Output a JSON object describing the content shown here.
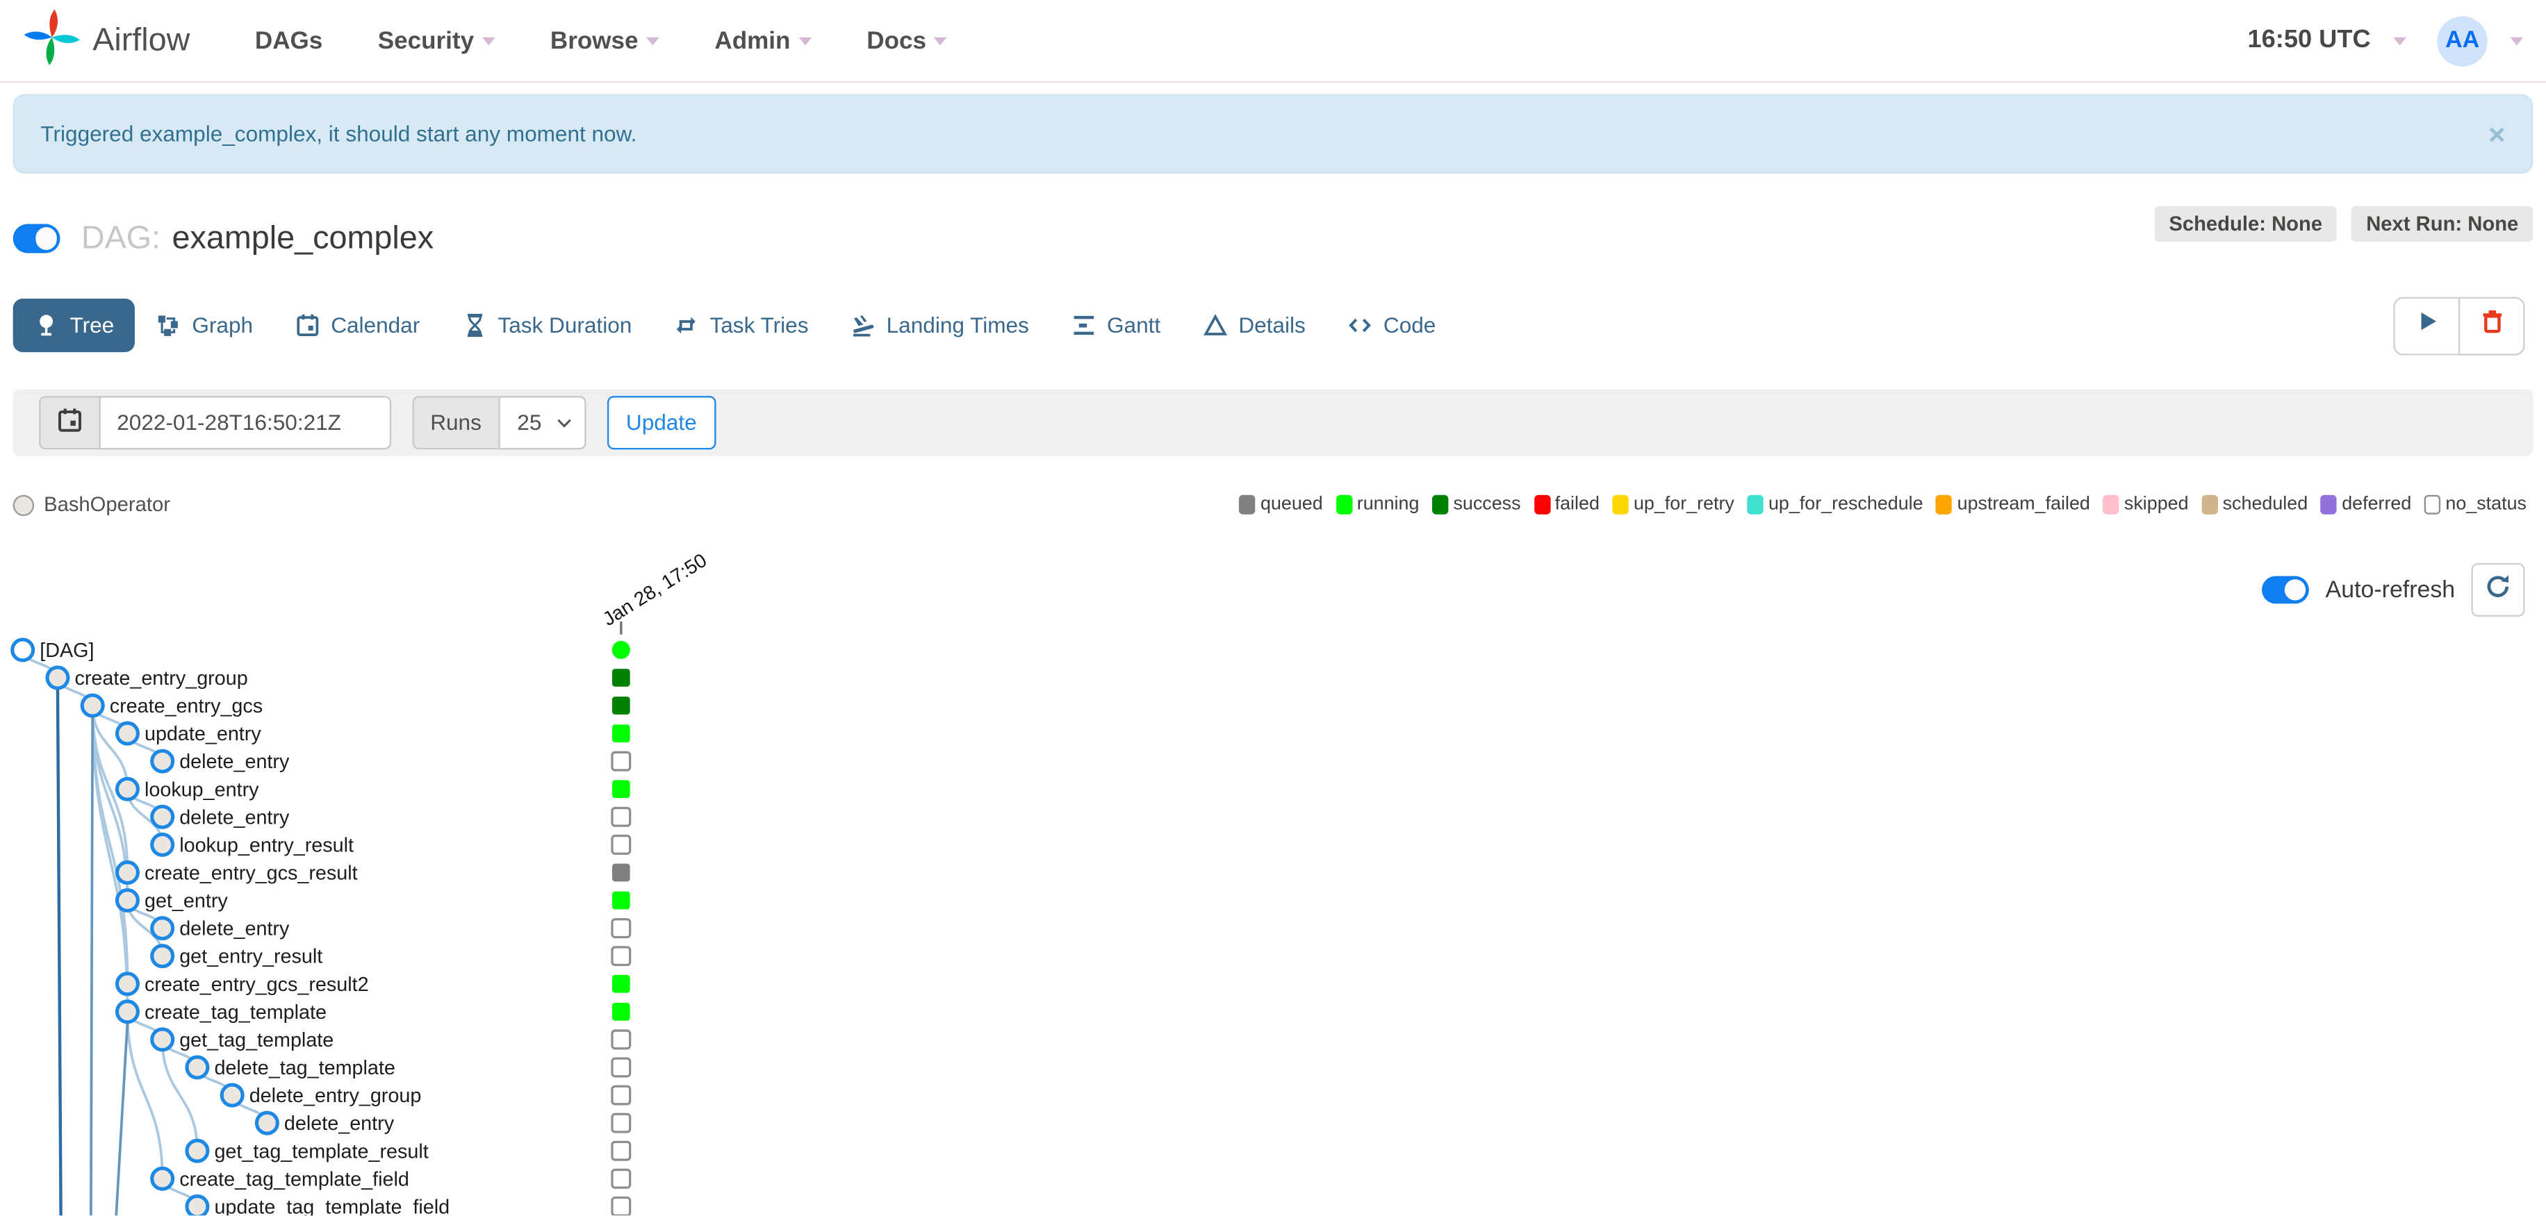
{
  "nav": {
    "brand": "Airflow",
    "items": [
      {
        "label": "DAGs",
        "caret": false
      },
      {
        "label": "Security",
        "caret": true
      },
      {
        "label": "Browse",
        "caret": true
      },
      {
        "label": "Admin",
        "caret": true
      },
      {
        "label": "Docs",
        "caret": true
      }
    ],
    "clock": "16:50 UTC",
    "avatar_initials": "AA"
  },
  "alert": {
    "message": "Triggered example_complex, it should start any moment now.",
    "close_symbol": "×"
  },
  "dag": {
    "label_prefix": "DAG:",
    "name": "example_complex",
    "schedule_badge": "Schedule: None",
    "next_run_badge": "Next Run: None"
  },
  "tabs": [
    {
      "label": "Tree",
      "icon": "tree-icon",
      "active": true
    },
    {
      "label": "Graph",
      "icon": "graph-icon",
      "active": false
    },
    {
      "label": "Calendar",
      "icon": "calendar-icon",
      "active": false
    },
    {
      "label": "Task Duration",
      "icon": "hourglass-icon",
      "active": false
    },
    {
      "label": "Task Tries",
      "icon": "repeat-icon",
      "active": false
    },
    {
      "label": "Landing Times",
      "icon": "plane-landing-icon",
      "active": false
    },
    {
      "label": "Gantt",
      "icon": "gantt-icon",
      "active": false
    },
    {
      "label": "Details",
      "icon": "details-icon",
      "active": false
    },
    {
      "label": "Code",
      "icon": "code-icon",
      "active": false
    }
  ],
  "filter": {
    "date_value": "2022-01-28T16:50:21Z",
    "runs_label": "Runs",
    "runs_selected": "25",
    "update_label": "Update"
  },
  "legend": {
    "operator": {
      "label": "BashOperator",
      "fill": "#ece6e0",
      "border": "#9a9a9a"
    },
    "statuses": [
      {
        "label": "queued",
        "color": "#808080"
      },
      {
        "label": "running",
        "color": "#00FF00"
      },
      {
        "label": "success",
        "color": "#008000"
      },
      {
        "label": "failed",
        "color": "#FF0000"
      },
      {
        "label": "up_for_retry",
        "color": "#FFD700"
      },
      {
        "label": "up_for_reschedule",
        "color": "#40E0D0"
      },
      {
        "label": "upstream_failed",
        "color": "#FFA500"
      },
      {
        "label": "skipped",
        "color": "#FFC0CB"
      },
      {
        "label": "scheduled",
        "color": "#D2B48C"
      },
      {
        "label": "deferred",
        "color": "#9370DB"
      },
      {
        "label": "no_status",
        "color": "#FFFFFF",
        "border": "#8E8E8E"
      }
    ]
  },
  "auto_refresh": {
    "label": "Auto-refresh",
    "enabled": true
  },
  "tree": {
    "run_label": "Jan 28, 17:50",
    "dag_run_status": "running",
    "node_fill": "#ece6e0",
    "node_stroke": "#1e88e5",
    "edge_color": "#aac8df",
    "nodes": [
      {
        "label": "[DAG]",
        "depth": 0,
        "parent": null,
        "status": "running",
        "root": true
      },
      {
        "label": "create_entry_group",
        "depth": 1,
        "parent": 0,
        "status": "success"
      },
      {
        "label": "create_entry_gcs",
        "depth": 2,
        "parent": 1,
        "status": "success"
      },
      {
        "label": "update_entry",
        "depth": 3,
        "parent": 2,
        "status": "running"
      },
      {
        "label": "delete_entry",
        "depth": 4,
        "parent": 3,
        "status": "no_status"
      },
      {
        "label": "lookup_entry",
        "depth": 3,
        "parent": 2,
        "status": "running"
      },
      {
        "label": "delete_entry",
        "depth": 4,
        "parent": 5,
        "status": "no_status"
      },
      {
        "label": "lookup_entry_result",
        "depth": 4,
        "parent": 5,
        "status": "no_status"
      },
      {
        "label": "create_entry_gcs_result",
        "depth": 3,
        "parent": 2,
        "status": "queued"
      },
      {
        "label": "get_entry",
        "depth": 3,
        "parent": 2,
        "status": "running"
      },
      {
        "label": "delete_entry",
        "depth": 4,
        "parent": 9,
        "status": "no_status"
      },
      {
        "label": "get_entry_result",
        "depth": 4,
        "parent": 9,
        "status": "no_status"
      },
      {
        "label": "create_entry_gcs_result2",
        "depth": 3,
        "parent": 2,
        "status": "running"
      },
      {
        "label": "create_tag_template",
        "depth": 3,
        "parent": 2,
        "status": "running"
      },
      {
        "label": "get_tag_template",
        "depth": 4,
        "parent": 13,
        "status": "no_status"
      },
      {
        "label": "delete_tag_template",
        "depth": 5,
        "parent": 14,
        "status": "no_status"
      },
      {
        "label": "delete_entry_group",
        "depth": 6,
        "parent": 15,
        "status": "no_status"
      },
      {
        "label": "delete_entry",
        "depth": 7,
        "parent": 16,
        "status": "no_status"
      },
      {
        "label": "get_tag_template_result",
        "depth": 5,
        "parent": 14,
        "status": "no_status"
      },
      {
        "label": "create_tag_template_field",
        "depth": 4,
        "parent": 13,
        "status": "no_status"
      },
      {
        "label": "update_tag_template_field",
        "depth": 5,
        "parent": 19,
        "status": "no_status"
      }
    ]
  }
}
